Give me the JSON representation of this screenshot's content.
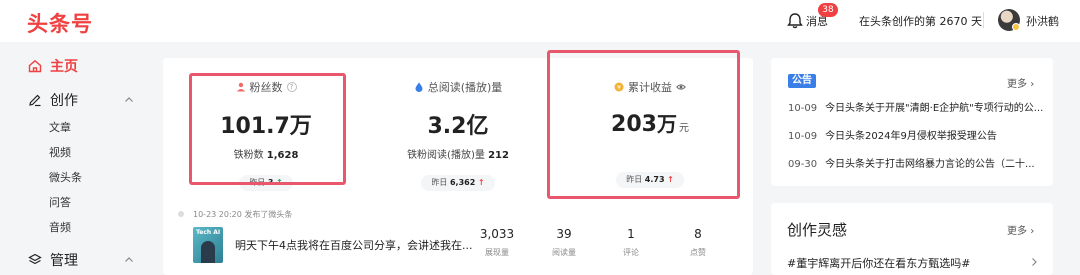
{
  "header": {
    "logo": "头条号",
    "messages_label": "消息",
    "messages_badge": "38",
    "days_text": "在头条创作的第 2670 天",
    "username": "孙洪鹤"
  },
  "sidebar": {
    "home": "主页",
    "create": "创作",
    "create_items": [
      "文章",
      "视频",
      "微头条",
      "问答",
      "音频"
    ],
    "manage": "管理"
  },
  "stats": {
    "fans": {
      "label": "粉丝数",
      "value": "101.7万",
      "sub_label": "铁粉数",
      "sub_value": "1,628",
      "yesterday_label": "昨日",
      "yesterday_value": "3"
    },
    "reads": {
      "label": "总阅读(播放)量",
      "value": "3.2亿",
      "sub_label": "铁粉阅读(播放)量",
      "sub_value": "212",
      "yesterday_label": "昨日",
      "yesterday_value": "6,362"
    },
    "income": {
      "label": "累计收益",
      "value_num": "203",
      "value_unit": "万",
      "value_suffix": "元",
      "yesterday_label": "昨日",
      "yesterday_value": "4.73"
    }
  },
  "feed": {
    "meta": "10-23 20:20  发布了微头条",
    "thumb_text": "Tech AI",
    "title": "明天下午4点我将在百度公司分享，会讲述我在...",
    "metrics": [
      {
        "value": "3,033",
        "label": "展现量"
      },
      {
        "value": "39",
        "label": "阅读量"
      },
      {
        "value": "1",
        "label": "评论"
      },
      {
        "value": "8",
        "label": "点赞"
      }
    ]
  },
  "notices": {
    "tag": "公告",
    "more": "更多",
    "items": [
      {
        "date": "10-09",
        "title": "今日头条关于开展\"清朗·E企护航\"专项行动的公..."
      },
      {
        "date": "10-09",
        "title": "今日头条2024年9月侵权举报受理公告"
      },
      {
        "date": "09-30",
        "title": "今日头条关于打击网络暴力言论的公告（二十..."
      }
    ]
  },
  "inspiration": {
    "title": "创作灵感",
    "more": "更多",
    "tag": "#董宇辉离开后你还在看东方甄选吗#"
  },
  "colors": {
    "brand_red": "#f04142",
    "highlight_box": "#e8576b",
    "notice_blue": "#3a7ee8"
  }
}
